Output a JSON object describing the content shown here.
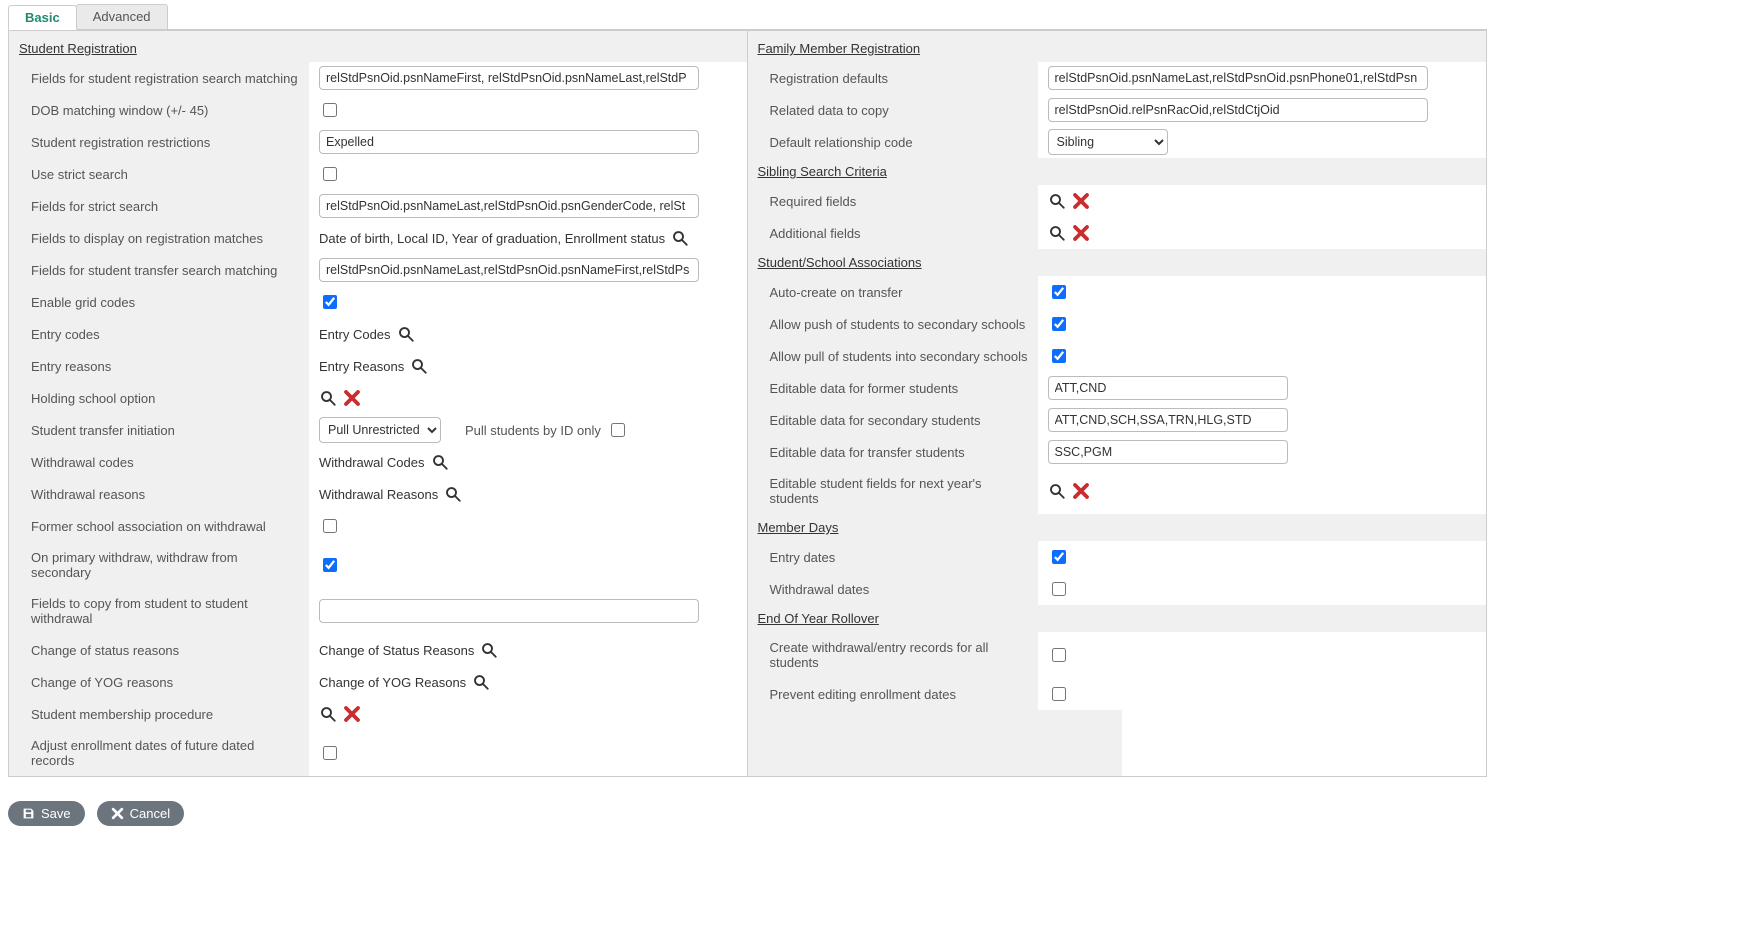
{
  "tabs": {
    "basic": "Basic",
    "advanced": "Advanced"
  },
  "sections": {
    "studentReg": "Student Registration",
    "familyReg": "Family Member Registration",
    "siblingSearch": "Sibling Search Criteria",
    "studentSchoolAssoc": "Student/School Associations",
    "memberDays": "Member Days",
    "eoy": "End Of Year Rollover"
  },
  "labels": {
    "fieldsRegSearch": "Fields for student registration search matching",
    "dobWindow": "DOB matching window (+/- 45)",
    "regRestrictions": "Student registration restrictions",
    "useStrict": "Use strict search",
    "fieldsStrict": "Fields for strict search",
    "fieldsDisplay": "Fields to display on registration matches",
    "fieldsTransfer": "Fields for student transfer search matching",
    "enableGrid": "Enable grid codes",
    "entryCodes": "Entry codes",
    "entryReasons": "Entry reasons",
    "holdingSchool": "Holding school option",
    "transferInit": "Student transfer initiation",
    "pullById": "Pull students by ID only",
    "withdrawalCodes": "Withdrawal codes",
    "withdrawalReasons": "Withdrawal reasons",
    "formerSchoolAssoc": "Former school association on withdrawal",
    "primaryWithdraw": "On primary withdraw, withdraw from secondary",
    "fieldsCopyWithdrawal": "Fields to copy from student to student withdrawal",
    "changeStatus": "Change of status reasons",
    "changeYOG": "Change of YOG reasons",
    "membershipProc": "Student membership procedure",
    "adjustEnrollDates": "Adjust enrollment dates of future dated records",
    "regDefaults": "Registration defaults",
    "relatedCopy": "Related data to copy",
    "defaultRelCode": "Default relationship code",
    "requiredFields": "Required fields",
    "additionalFields": "Additional fields",
    "autoCreate": "Auto-create on transfer",
    "allowPush": "Allow push of students to secondary schools",
    "allowPull": "Allow pull of students into secondary schools",
    "editFormer": "Editable data for former students",
    "editSecondary": "Editable data for secondary students",
    "editTransfer": "Editable data for transfer students",
    "editNextYear": "Editable student fields for next year's students",
    "entryDates": "Entry dates",
    "withdrawalDates": "Withdrawal dates",
    "createWERecords": "Create withdrawal/entry records for all students",
    "preventEditDates": "Prevent editing enrollment dates"
  },
  "values": {
    "fieldsRegSearch": "relStdPsnOid.psnNameFirst, relStdPsnOid.psnNameLast,relStdP",
    "regRestrictions": "Expelled",
    "fieldsStrict": "relStdPsnOid.psnNameLast,relStdPsnOid.psnGenderCode, relSt",
    "fieldsDisplayText": "Date of birth, Local ID, Year of graduation, Enrollment status",
    "fieldsTransfer": "relStdPsnOid.psnNameLast,relStdPsnOid.psnNameFirst,relStdPs",
    "entryCodesText": "Entry Codes",
    "entryReasonsText": "Entry Reasons",
    "transferInitSelect": "Pull Unrestricted",
    "withdrawalCodesText": "Withdrawal Codes",
    "withdrawalReasonsText": "Withdrawal Reasons",
    "fieldsCopyWithdrawal": "",
    "changeStatusText": "Change of Status Reasons",
    "changeYOGText": "Change of YOG Reasons",
    "regDefaults": "relStdPsnOid.psnNameLast,relStdPsnOid.psnPhone01,relStdPsn",
    "relatedCopy": "relStdPsnOid.relPsnRacOid,relStdCtjOid",
    "defaultRelCode": "Sibling",
    "editFormer": "ATT,CND",
    "editSecondary": "ATT,CND,SCH,SSA,TRN,HLG,STD",
    "editTransfer": "SSC,PGM"
  },
  "checks": {
    "dobWindow": false,
    "useStrict": false,
    "enableGrid": true,
    "formerSchoolAssoc": false,
    "primaryWithdraw": true,
    "adjustEnrollDates": false,
    "pullById": false,
    "autoCreate": true,
    "allowPush": true,
    "allowPull": true,
    "entryDates": true,
    "withdrawalDates": false,
    "createWERecords": false,
    "preventEditDates": false
  },
  "footer": {
    "save": "Save",
    "cancel": "Cancel"
  }
}
